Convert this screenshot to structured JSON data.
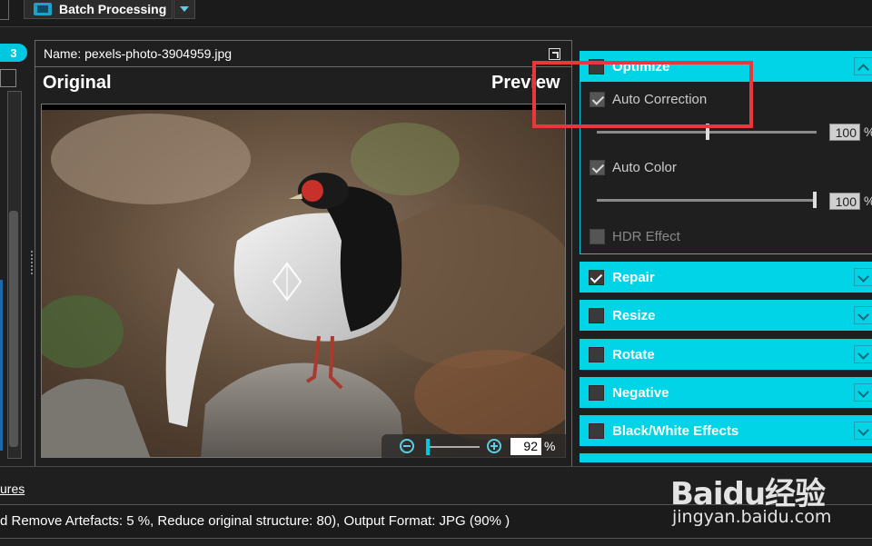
{
  "toolbar": {
    "batch_label": "Batch Processing"
  },
  "left_panel": {
    "count_badge": "3"
  },
  "viewer": {
    "file_name": "Name: pexels-photo-3904959.jpg",
    "label_original": "Original",
    "label_preview": "Preview",
    "zoom_value": "92",
    "zoom_unit": "%"
  },
  "right_panel": {
    "sections": [
      {
        "label": "Optimize",
        "checked": false,
        "expanded": true
      },
      {
        "label": "Repair",
        "checked": true,
        "expanded": false
      },
      {
        "label": "Resize",
        "checked": false,
        "expanded": false
      },
      {
        "label": "Rotate",
        "checked": false,
        "expanded": false
      },
      {
        "label": "Negative",
        "checked": false,
        "expanded": false
      },
      {
        "label": "Black/White Effects",
        "checked": false,
        "expanded": false
      }
    ],
    "options": {
      "auto_correction": {
        "label": "Auto Correction",
        "checked": true,
        "value": "100",
        "unit": "%",
        "level": 0.5
      },
      "auto_color": {
        "label": "Auto Color",
        "checked": true,
        "value": "100",
        "unit": "%",
        "level": 1.0
      },
      "hdr_effect": {
        "label": "HDR Effect",
        "checked": false
      }
    }
  },
  "bottom": {
    "link_text": "ures",
    "status_text": "d Remove Artefacts: 5 %, Reduce original structure: 80), Output Format: JPG (90% )"
  },
  "watermark": {
    "brand": "Baidu经验",
    "url": "jingyan.baidu.com"
  },
  "colors": {
    "accent": "#00d4e6",
    "highlight": "#e8383b",
    "background": "#1f1f1f"
  }
}
